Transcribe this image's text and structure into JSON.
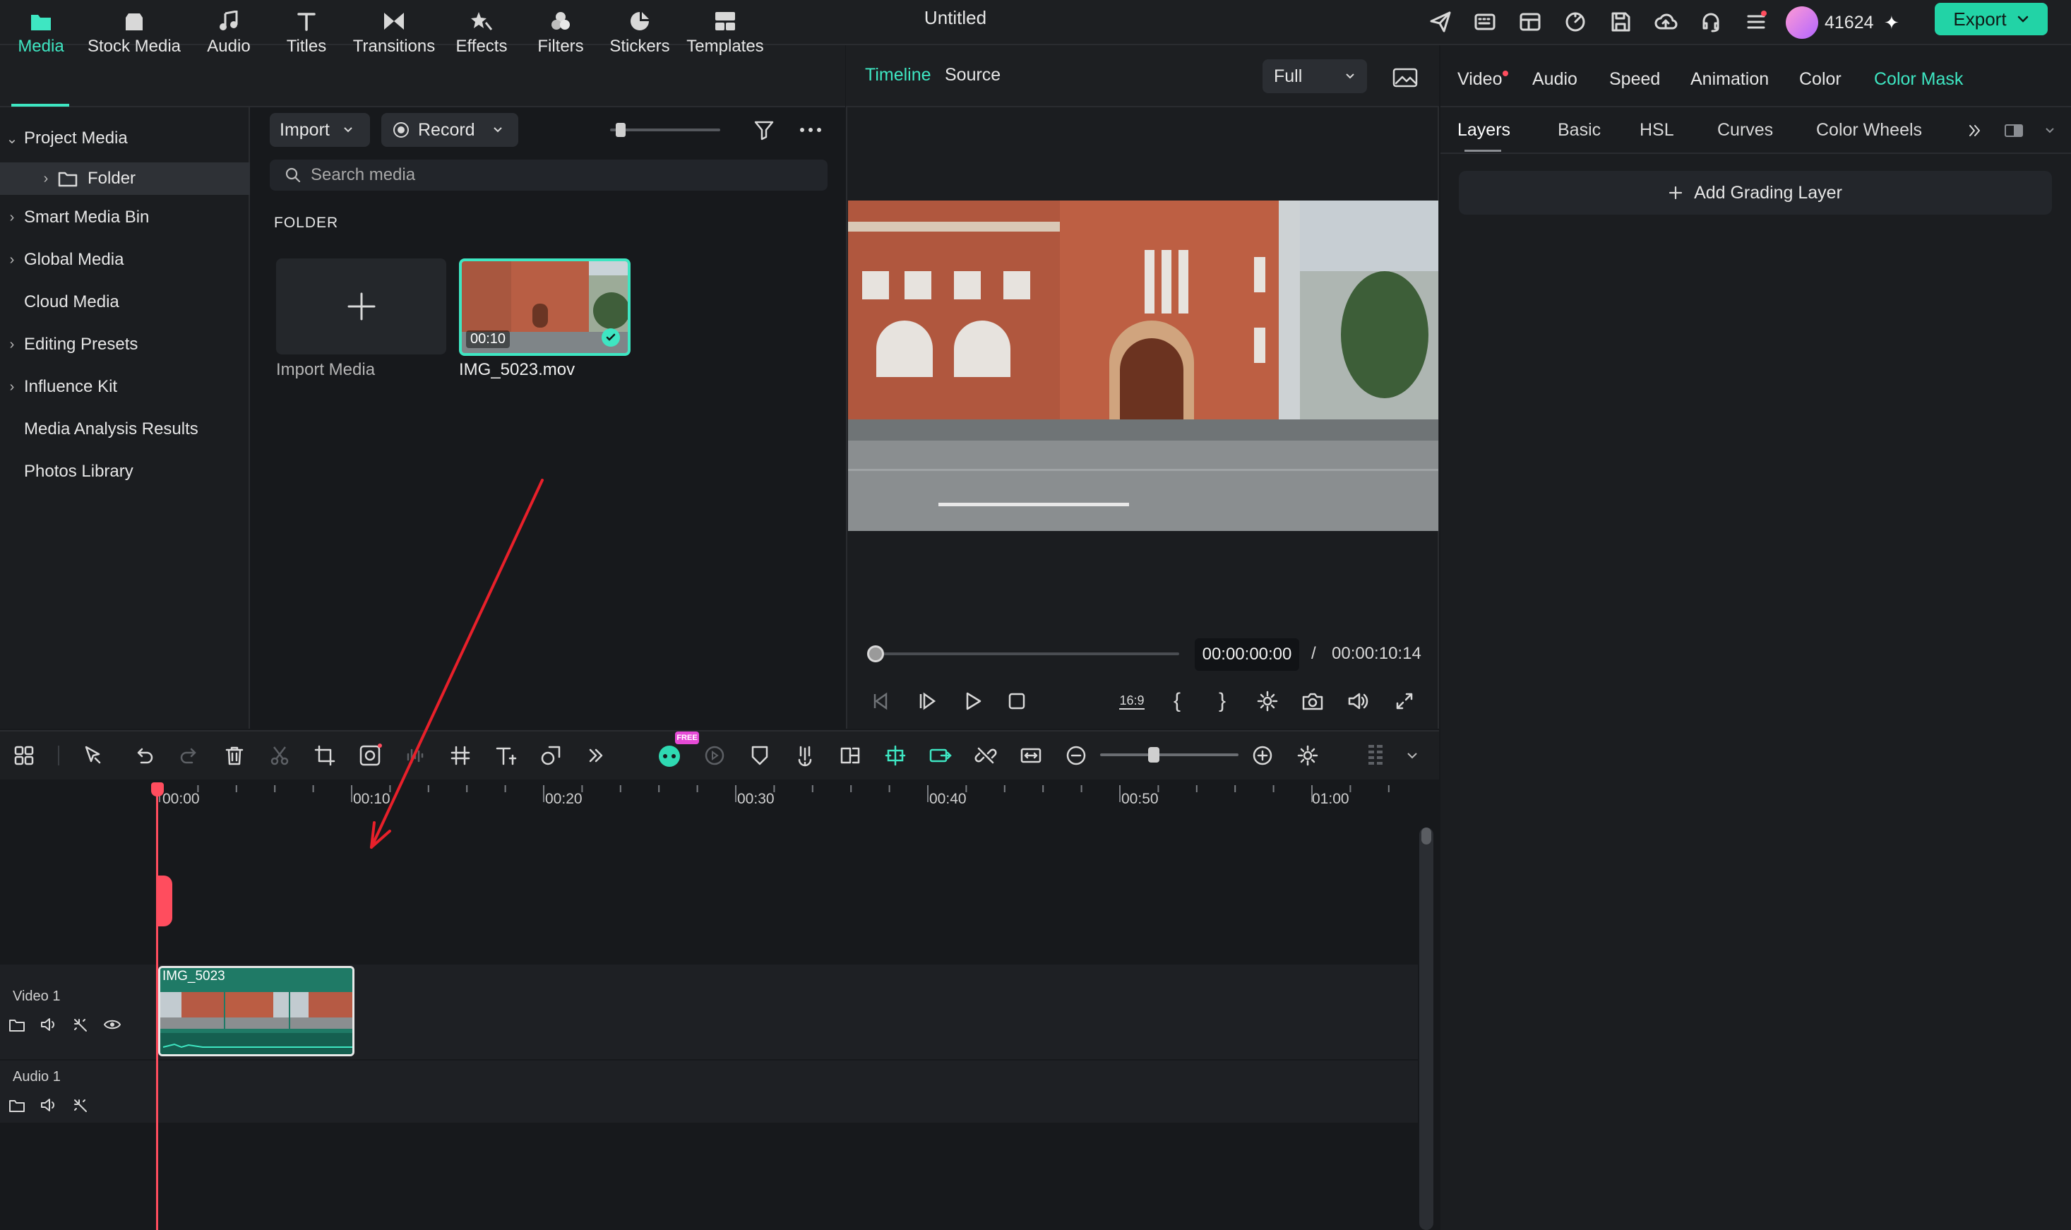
{
  "window": {
    "title": "Untitled"
  },
  "account": {
    "credits": "41624",
    "credits_plus": "✦"
  },
  "export": {
    "label": "Export"
  },
  "media_tabs": [
    {
      "label": "Media"
    },
    {
      "label": "Stock Media"
    },
    {
      "label": "Audio"
    },
    {
      "label": "Titles"
    },
    {
      "label": "Transitions"
    },
    {
      "label": "Effects"
    },
    {
      "label": "Filters"
    },
    {
      "label": "Stickers"
    },
    {
      "label": "Templates"
    }
  ],
  "sidebar": {
    "items": [
      {
        "label": "Project Media"
      },
      {
        "label": "Folder"
      },
      {
        "label": "Smart Media Bin"
      },
      {
        "label": "Global Media"
      },
      {
        "label": "Cloud Media"
      },
      {
        "label": "Editing Presets"
      },
      {
        "label": "Influence Kit"
      },
      {
        "label": "Media Analysis Results"
      },
      {
        "label": "Photos Library"
      }
    ]
  },
  "media_browser": {
    "import_label": "Import",
    "record_label": "Record",
    "search_placeholder": "Search media",
    "folder_heading": "FOLDER",
    "import_media_label": "Import Media",
    "clip": {
      "name": "IMG_5023.mov",
      "duration": "00:10"
    }
  },
  "player": {
    "tabs": [
      {
        "label": "Timeline"
      },
      {
        "label": "Source"
      }
    ],
    "quality": "Full",
    "timecode_current": "00:00:00:00",
    "timecode_separator": "/",
    "timecode_total": "00:00:10:14",
    "aspect_label": "16:9"
  },
  "inspector": {
    "tabs": [
      {
        "label": "Video"
      },
      {
        "label": "Audio"
      },
      {
        "label": "Speed"
      },
      {
        "label": "Animation"
      },
      {
        "label": "Color"
      },
      {
        "label": "Color Mask"
      }
    ],
    "subtabs": [
      {
        "label": "Layers"
      },
      {
        "label": "Basic"
      },
      {
        "label": "HSL"
      },
      {
        "label": "Curves"
      },
      {
        "label": "Color Wheels"
      }
    ],
    "add_grading_layer": "Add Grading Layer"
  },
  "timeline": {
    "ruler_labels": [
      "00:00",
      "00:10",
      "00:20",
      "00:30",
      "00:40",
      "00:50",
      "01:00"
    ],
    "tracks": [
      {
        "name": "Video 1"
      },
      {
        "name": "Audio 1"
      }
    ],
    "clip_name": "IMG_5023",
    "ai_badge": "FREE"
  },
  "colors": {
    "accent": "#3ee6c2",
    "export": "#22d3a6",
    "playhead": "#ff4d5e",
    "annotation": "#e8202a"
  }
}
